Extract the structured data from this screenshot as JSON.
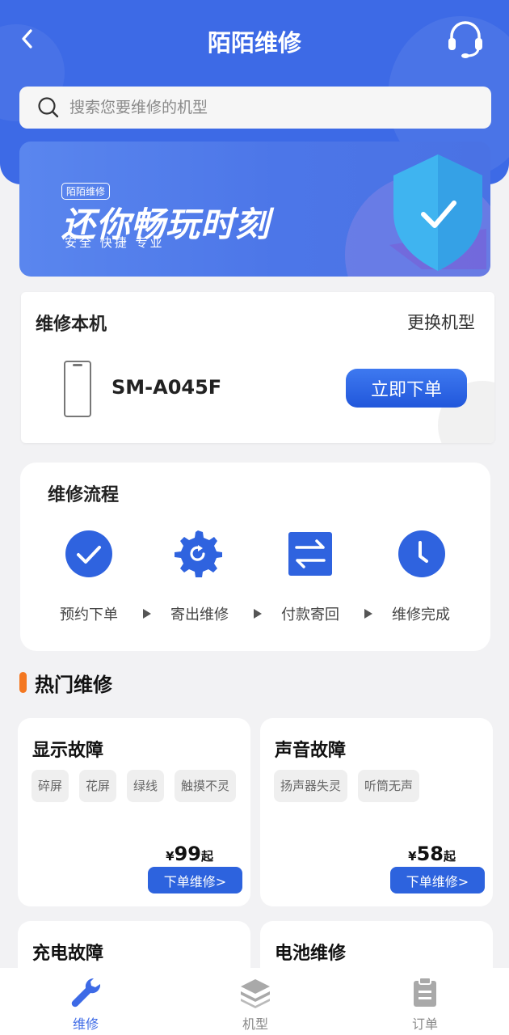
{
  "header": {
    "title": "陌陌维修",
    "back_icon": "back-arrow-icon",
    "service_icon": "headset-icon"
  },
  "search": {
    "placeholder": "搜索您要维修的机型"
  },
  "banner": {
    "tag": "陌陌维修",
    "slogan": "还你畅玩时刻",
    "sub": "安全 快捷 专业",
    "icon": "shield-check-icon"
  },
  "device": {
    "title": "维修本机",
    "switch_label": "更换机型",
    "model": "SM-A045F",
    "order_label": "立即下单",
    "icon": "phone-outline-icon"
  },
  "flow": {
    "title": "维修流程",
    "steps": [
      {
        "label": "预约下单",
        "icon": "check-circle-icon"
      },
      {
        "label": "寄出维修",
        "icon": "gear-refresh-icon"
      },
      {
        "label": "付款寄回",
        "icon": "exchange-arrows-icon"
      },
      {
        "label": "维修完成",
        "icon": "clock-icon"
      }
    ]
  },
  "hot": {
    "title": "热门维修",
    "cards": [
      {
        "name": "显示故障",
        "chips": [
          "碎屏",
          "花屏",
          "绿线",
          "触摸不灵"
        ],
        "currency": "¥",
        "price": "99",
        "suffix": "起",
        "button": "下单维修>"
      },
      {
        "name": "声音故障",
        "chips": [
          "扬声器失灵",
          "听筒无声"
        ],
        "currency": "¥",
        "price": "58",
        "suffix": "起",
        "button": "下单维修>"
      },
      {
        "name": "充电故障"
      },
      {
        "name": "电池维修"
      }
    ]
  },
  "tabbar": {
    "items": [
      {
        "label": "维修",
        "icon": "wrench-icon",
        "active": true
      },
      {
        "label": "机型",
        "icon": "layers-icon",
        "active": false
      },
      {
        "label": "订单",
        "icon": "clipboard-icon",
        "active": false
      }
    ]
  },
  "colors": {
    "primary": "#3d6ae6",
    "accent": "#f47720",
    "button": "#2d63de"
  }
}
